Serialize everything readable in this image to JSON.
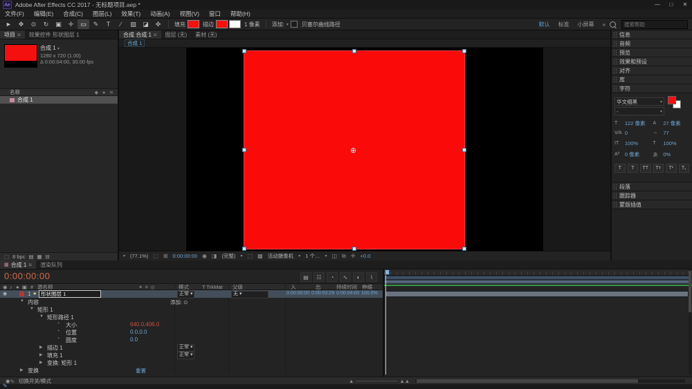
{
  "window": {
    "title": "Adobe After Effects CC 2017 - 无标题项目.aep *",
    "app_badge": "Ae",
    "controls": {
      "minimize": "—",
      "maximize": "□",
      "close": "✕"
    }
  },
  "menu": {
    "items": [
      "文件(F)",
      "编辑(E)",
      "合成(C)",
      "图层(L)",
      "效果(T)",
      "动画(A)",
      "视图(V)",
      "窗口",
      "帮助(H)"
    ]
  },
  "icons": {
    "burger": "≡",
    "chevron": "▾",
    "eye": "◉",
    "star": "★",
    "stopwatch": "◔",
    "anchor": "⊕",
    "pen": "✎",
    "comp_item": "▦",
    "solo": "●",
    "audio": "♪",
    "lock": "▣",
    "add_dot": "⊙"
  },
  "toolbar": {
    "tools": [
      {
        "name": "selection-tool",
        "glyph": "►",
        "selected": false
      },
      {
        "name": "hand-tool",
        "glyph": "✥",
        "selected": false
      },
      {
        "name": "zoom-tool",
        "glyph": "⊙",
        "selected": false
      },
      {
        "name": "rotation-tool",
        "glyph": "↻",
        "selected": false
      },
      {
        "name": "camera-tool",
        "glyph": "▣",
        "selected": false
      },
      {
        "name": "pan-behind-tool",
        "glyph": "✛",
        "selected": false
      },
      {
        "name": "rectangle-tool",
        "glyph": "▭",
        "selected": true
      },
      {
        "name": "pen-tool",
        "glyph": "✎",
        "selected": false
      },
      {
        "name": "type-tool",
        "glyph": "T",
        "selected": false
      },
      {
        "name": "brush-tool",
        "glyph": "∕",
        "selected": false
      },
      {
        "name": "clone-stamp-tool",
        "glyph": "▧",
        "selected": false
      },
      {
        "name": "eraser-tool",
        "glyph": "◪",
        "selected": false
      },
      {
        "name": "puppet-pin-tool",
        "glyph": "✜",
        "selected": false
      }
    ],
    "fill": {
      "label": "填充",
      "color": "#f51010"
    },
    "stroke": {
      "label": "描边",
      "color": "#f51010",
      "width": "1 像素"
    },
    "add_label": "添加:",
    "bezier_label": "贝塞尔曲线路径",
    "workspaces": {
      "items": [
        "默认",
        "标准",
        "小屏幕"
      ],
      "active": "默认",
      "overflow": "»"
    },
    "search_placeholder": "搜索帮助"
  },
  "project": {
    "tabs": [
      {
        "label": "项目",
        "active": true
      },
      {
        "label": "效果控件 形状图层 1",
        "active": false
      }
    ],
    "preview": {
      "name": "合成 1",
      "line1": "1280 x 720 (1.00)",
      "line2": "Δ 0:00:04:00, 30.00 fps"
    },
    "name_column": "名称",
    "items": [
      {
        "label": "合成 1",
        "selected": true
      }
    ],
    "footer": {
      "depth": "8 bpc"
    }
  },
  "viewer": {
    "tabs": [
      {
        "label": "合成 合成 1",
        "active": true
      },
      {
        "label": "图层 (无)",
        "active": false
      },
      {
        "label": "素材 (无)",
        "active": false
      }
    ],
    "breadcrumb": "合成 1",
    "statusbar": {
      "zoom": "(77.1%)",
      "timecode": "0:00:00:00",
      "resolution": "(完整)",
      "camera": "活动摄像机",
      "view_layout": "1 个…",
      "exposure": "+0.0"
    }
  },
  "dock": {
    "top_panels": [
      "信息",
      "音频",
      "预览",
      "效果和预设",
      "对齐",
      "库"
    ],
    "character": {
      "title": "字符",
      "font_family": "华文细黑",
      "font_style": "-",
      "rows": [
        {
          "icon": "T",
          "value": "122 像素",
          "icon2": "A",
          "value2": "27 像素"
        },
        {
          "icon": "V⁄A",
          "value": "0",
          "icon2": "⇔",
          "value2": "77"
        },
        {
          "icon": "IT",
          "value": "100%",
          "icon2": "T",
          "value2": "100%"
        },
        {
          "icon": "Aª",
          "value": "0 像素",
          "icon2": "あ",
          "value2": "0%"
        }
      ],
      "style_buttons": [
        "T",
        "T",
        "TT",
        "Tт",
        "T¹",
        "T₁"
      ]
    },
    "bottom_panels": [
      "段落",
      "跟踪器",
      "蒙版插值"
    ]
  },
  "timeline": {
    "tabs": [
      {
        "label": "合成 1",
        "active": true
      },
      {
        "label": "渲染队列",
        "active": false
      }
    ],
    "timecode": "0:00:00:00",
    "header_icons": [
      {
        "name": "composition-mini-flowchart-icon",
        "glyph": "▤"
      },
      {
        "name": "draft-3d-icon",
        "glyph": "☷"
      },
      {
        "name": "hide-shy-layers-icon",
        "glyph": "◔"
      },
      {
        "name": "frame-blending-icon",
        "glyph": "∿"
      },
      {
        "name": "motion-blur-icon",
        "glyph": "◐"
      },
      {
        "name": "graph-editor-icon",
        "glyph": "⌇"
      }
    ],
    "columns": {
      "index": "#",
      "source": "源名称",
      "mode": "模式",
      "trkmat": "T TrkMat",
      "parent": "父级",
      "in": "入",
      "out": "出",
      "duration": "持续时间",
      "stretch": "伸缩"
    },
    "layer": {
      "index": "1",
      "name": "形状图层 1",
      "mode": "正常",
      "parent": "无",
      "in": "0:00:00:00",
      "out": "0:00:03:29",
      "duration": "0:00:04:00",
      "stretch": "100.0%"
    },
    "add_label": "添加:",
    "reset_label": "重置",
    "properties": [
      {
        "type": "group",
        "indent": 0,
        "state": "open",
        "label": "内容",
        "right": "add"
      },
      {
        "type": "group",
        "indent": 1,
        "state": "open",
        "label": "矩形 1"
      },
      {
        "type": "group",
        "indent": 2,
        "state": "open",
        "label": "矩形路径 1"
      },
      {
        "type": "prop",
        "indent": 3,
        "label": "大小",
        "value": "640.0,406.0",
        "red": true
      },
      {
        "type": "prop",
        "indent": 3,
        "label": "位置",
        "value": "0.0,0.0"
      },
      {
        "type": "prop",
        "indent": 3,
        "label": "圆度",
        "value": "0.0"
      },
      {
        "type": "group",
        "indent": 2,
        "state": "closed",
        "label": "描边 1",
        "mode": "正常"
      },
      {
        "type": "group",
        "indent": 2,
        "state": "closed",
        "label": "填充 1",
        "mode": "正常"
      },
      {
        "type": "group",
        "indent": 2,
        "state": "closed",
        "label": "变换: 矩形 1"
      },
      {
        "type": "group",
        "indent": 0,
        "state": "closed",
        "label": "变换",
        "right": "reset"
      }
    ],
    "footer": {
      "toggle": "切换开关/模式"
    }
  },
  "colors": {
    "accent_blue": "#6ea5d4",
    "value_red": "#cf4f44",
    "fill_red": "#f51010",
    "timecode_warm": "#cf6a4a",
    "cache_green": "#3c9144"
  }
}
